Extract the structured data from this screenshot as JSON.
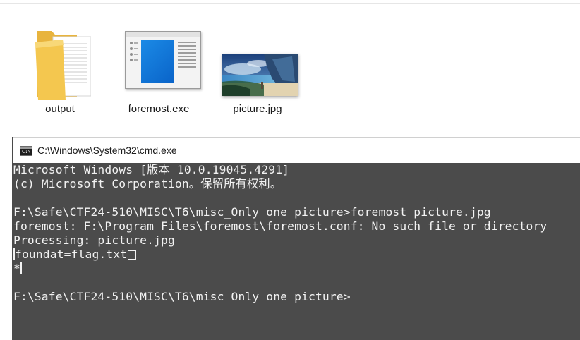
{
  "desktop": {
    "items": [
      {
        "label": "output",
        "icon": "folder-icon"
      },
      {
        "label": "foremost.exe",
        "icon": "application-icon"
      },
      {
        "label": "picture.jpg",
        "icon": "image-thumbnail"
      }
    ]
  },
  "cmd": {
    "title": "C:\\Windows\\System32\\cmd.exe",
    "icon_text": "C:\\",
    "lines": [
      "Microsoft Windows [版本 10.0.19045.4291]",
      "(c) Microsoft Corporation。保留所有权利。",
      "",
      "F:\\Safe\\CTF24-510\\MISC\\T6\\misc_Only one picture>foremost picture.jpg",
      "foremost: F:\\Program Files\\foremost\\foremost.conf: No such file or directory",
      "Processing: picture.jpg",
      "foundat=flag.txt",
      "*",
      "",
      "F:\\Safe\\CTF24-510\\MISC\\T6\\misc_Only one picture>"
    ],
    "colors": {
      "background": "#4b4b4b",
      "text": "#f2f2f2"
    }
  }
}
